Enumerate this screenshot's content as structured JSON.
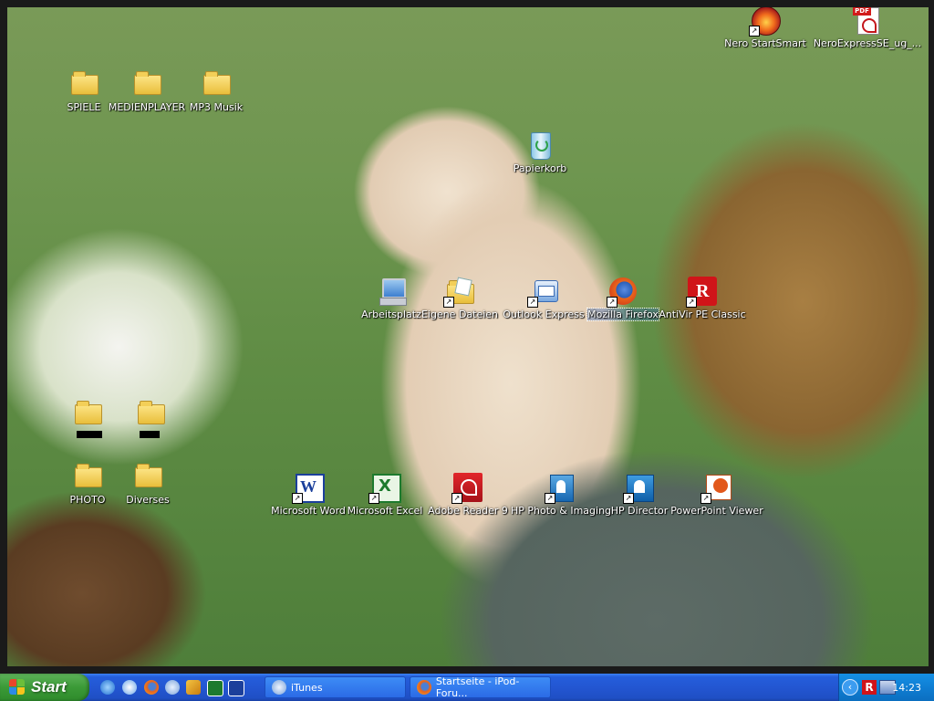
{
  "desktop": {
    "icons": [
      {
        "label": "SPIELE",
        "icon": "folder-icon"
      },
      {
        "label": "MEDIENPLAYER",
        "icon": "folder-icon"
      },
      {
        "label": "MP3 Musik",
        "icon": "folder-icon"
      },
      {
        "label": "Nero StartSmart",
        "icon": "nero-icon"
      },
      {
        "label": "NeroExpressSE_ug_...",
        "icon": "pdf-icon"
      },
      {
        "label": "Papierkorb",
        "icon": "recycle-bin-icon"
      },
      {
        "label": "Arbeitsplatz",
        "icon": "my-computer-icon"
      },
      {
        "label": "Eigene Dateien",
        "icon": "my-documents-icon"
      },
      {
        "label": "Outlook Express",
        "icon": "outlook-express-icon"
      },
      {
        "label": "Mozilla Firefox",
        "icon": "firefox-icon"
      },
      {
        "label": "AntiVir PE Classic",
        "icon": "antivir-icon"
      },
      {
        "label": "PHOTO",
        "icon": "folder-icon"
      },
      {
        "label": "Diverses",
        "icon": "folder-icon"
      },
      {
        "label": "Microsoft Word",
        "icon": "word-icon"
      },
      {
        "label": "Microsoft Excel",
        "icon": "excel-icon"
      },
      {
        "label": "Adobe Reader 9",
        "icon": "adobe-reader-icon"
      },
      {
        "label": "HP Photo & Imaging",
        "icon": "hp-photo-icon"
      },
      {
        "label": "HP Director",
        "icon": "hp-director-icon"
      },
      {
        "label": "PowerPoint Viewer",
        "icon": "powerpoint-icon"
      }
    ]
  },
  "taskbar": {
    "start_label": "Start",
    "quick_launch": [
      "ie-icon",
      "media-player-icon",
      "firefox-icon",
      "itunes-icon",
      "winamp-icon",
      "excel-icon",
      "word-icon"
    ],
    "tasks": [
      {
        "label": "iTunes",
        "icon": "itunes-icon"
      },
      {
        "label": "Startseite - iPod-Foru...",
        "icon": "firefox-icon"
      }
    ],
    "tray": {
      "icons": [
        "chevron-left-icon",
        "antivir-tray-icon",
        "network-icon"
      ],
      "clock": "14:23"
    }
  },
  "colors": {
    "taskbar_blue": "#245edb",
    "start_green": "#3b9a37",
    "tray_blue": "#0f7ed3"
  }
}
